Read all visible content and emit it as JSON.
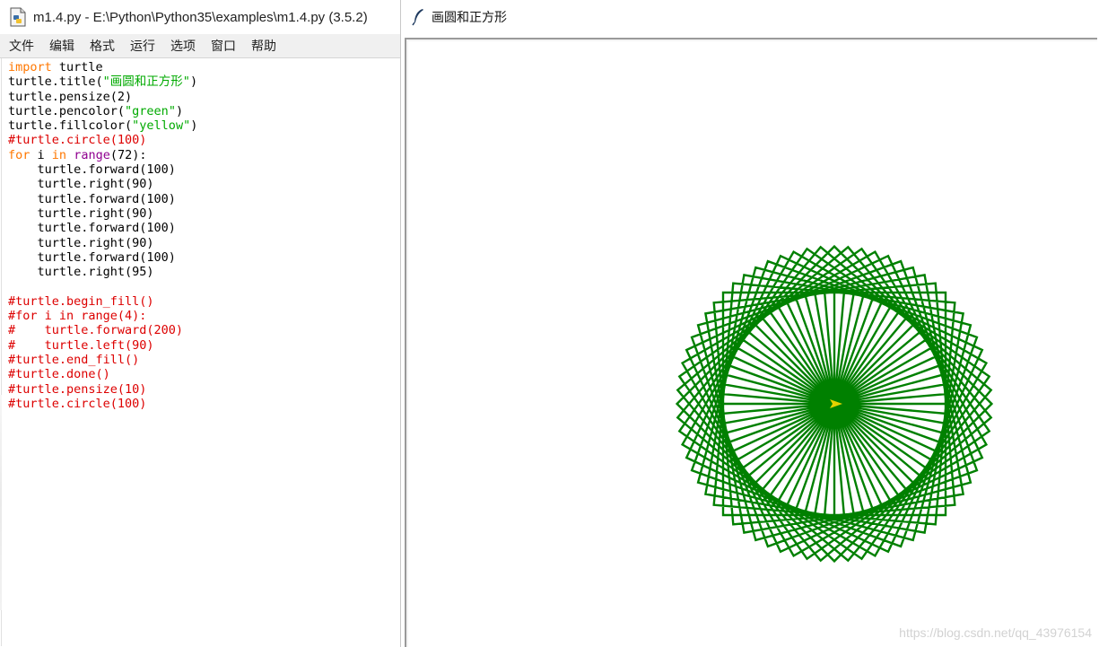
{
  "idle_window": {
    "title": "m1.4.py - E:\\Python\\Python35\\examples\\m1.4.py (3.5.2)",
    "menu": [
      "文件",
      "编辑",
      "格式",
      "运行",
      "选项",
      "窗口",
      "帮助"
    ],
    "code": [
      [
        {
          "t": "import",
          "c": "kw"
        },
        {
          "t": " turtle",
          "c": "plain"
        }
      ],
      [
        {
          "t": "turtle.title(",
          "c": "plain"
        },
        {
          "t": "\"画圆和正方形\"",
          "c": "str"
        },
        {
          "t": ")",
          "c": "plain"
        }
      ],
      [
        {
          "t": "turtle.pensize(2)",
          "c": "plain"
        }
      ],
      [
        {
          "t": "turtle.pencolor(",
          "c": "plain"
        },
        {
          "t": "\"green\"",
          "c": "str"
        },
        {
          "t": ")",
          "c": "plain"
        }
      ],
      [
        {
          "t": "turtle.fillcolor(",
          "c": "plain"
        },
        {
          "t": "\"yellow\"",
          "c": "str"
        },
        {
          "t": ")",
          "c": "plain"
        }
      ],
      [
        {
          "t": "#turtle.circle(100)",
          "c": "cm"
        }
      ],
      [
        {
          "t": "for",
          "c": "kw"
        },
        {
          "t": " i ",
          "c": "plain"
        },
        {
          "t": "in",
          "c": "kw"
        },
        {
          "t": " ",
          "c": "plain"
        },
        {
          "t": "range",
          "c": "bi"
        },
        {
          "t": "(72):",
          "c": "plain"
        }
      ],
      [
        {
          "t": "    turtle.forward(100)",
          "c": "plain"
        }
      ],
      [
        {
          "t": "    turtle.right(90)",
          "c": "plain"
        }
      ],
      [
        {
          "t": "    turtle.forward(100)",
          "c": "plain"
        }
      ],
      [
        {
          "t": "    turtle.right(90)",
          "c": "plain"
        }
      ],
      [
        {
          "t": "    turtle.forward(100)",
          "c": "plain"
        }
      ],
      [
        {
          "t": "    turtle.right(90)",
          "c": "plain"
        }
      ],
      [
        {
          "t": "    turtle.forward(100)",
          "c": "plain"
        }
      ],
      [
        {
          "t": "    turtle.right(95)",
          "c": "plain"
        }
      ],
      [],
      [
        {
          "t": "#turtle.begin_fill()",
          "c": "cm"
        }
      ],
      [
        {
          "t": "#for i in range(4):",
          "c": "cm"
        }
      ],
      [
        {
          "t": "#    turtle.forward(200)",
          "c": "cm"
        }
      ],
      [
        {
          "t": "#    turtle.left(90)",
          "c": "cm"
        }
      ],
      [
        {
          "t": "#turtle.end_fill()",
          "c": "cm"
        }
      ],
      [
        {
          "t": "#turtle.done()",
          "c": "cm"
        }
      ],
      [
        {
          "t": "#turtle.pensize(10)",
          "c": "cm"
        }
      ],
      [
        {
          "t": "#turtle.circle(100)",
          "c": "cm"
        }
      ]
    ],
    "icons": [
      "python-file-icon"
    ]
  },
  "turtle_window": {
    "title": "画圆和正方形",
    "icon": "feather-icon",
    "drawing": {
      "pen_color": "#008000",
      "pen_size": 2,
      "turtle_color": "#e5d200",
      "repeats": 72,
      "side_length": 100,
      "turn_angles": [
        90,
        90,
        90,
        95
      ]
    },
    "watermark": "https://blog.csdn.net/qq_43976154"
  },
  "colors": {
    "keyword": "#ff7700",
    "builtin": "#900090",
    "string": "#00aa00",
    "comment": "#dd0000"
  }
}
